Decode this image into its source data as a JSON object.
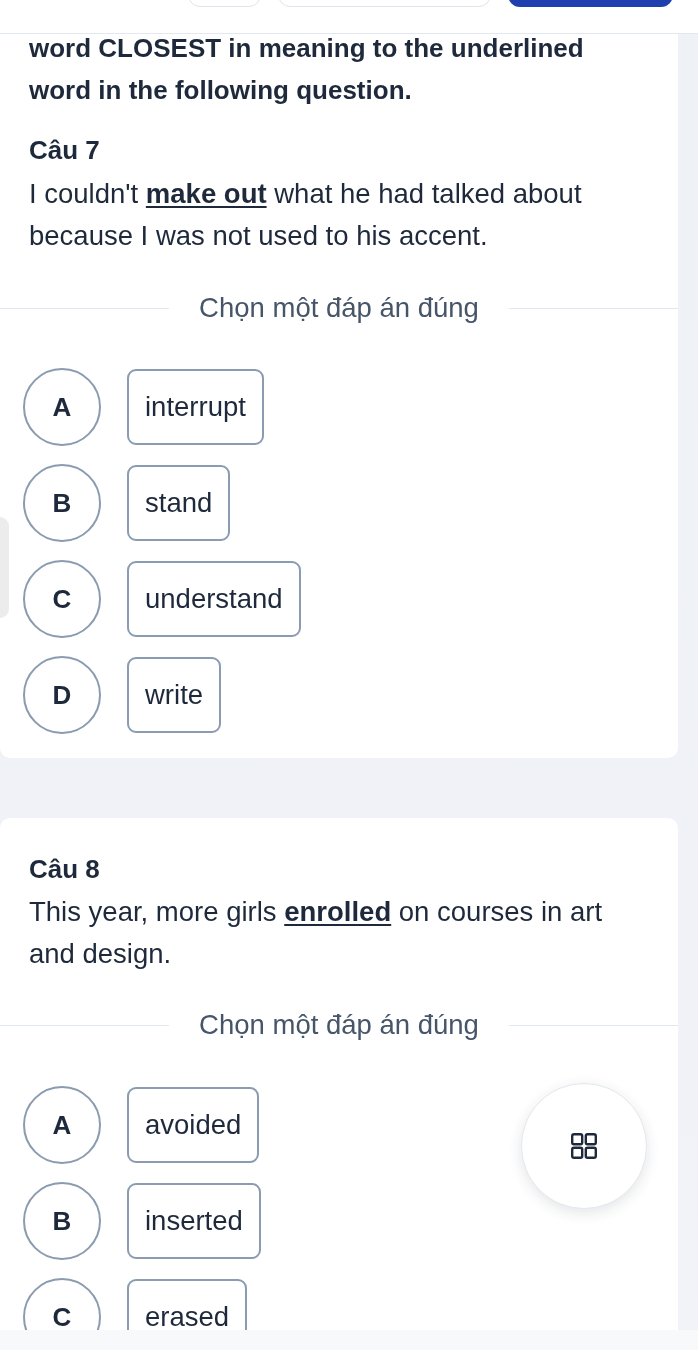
{
  "header": {
    "buttons": [
      {
        "kind": "outline"
      },
      {
        "kind": "outline"
      },
      {
        "kind": "primary"
      }
    ]
  },
  "questions": [
    {
      "instruction": "word CLOSEST in meaning to the underlined word in the following question.",
      "title": "Câu 7",
      "text": "I couldn't **make out** what he had talked about because I was not used to his accent.",
      "prompt": "Chọn một đáp án đúng",
      "options": [
        {
          "letter": "A",
          "text": "interrupt",
          "selected": false
        },
        {
          "letter": "B",
          "text": "stand",
          "selected": false
        },
        {
          "letter": "C",
          "text": "understand",
          "selected": false
        },
        {
          "letter": "D",
          "text": "write",
          "selected": false
        }
      ]
    },
    {
      "title": "Câu 8",
      "text": "This year, more girls **enrolled** on courses in art and design.",
      "prompt": "Chọn một đáp án đúng",
      "options": [
        {
          "letter": "A",
          "text": "avoided",
          "selected": false
        },
        {
          "letter": "B",
          "text": "inserted",
          "selected": false
        },
        {
          "letter": "C",
          "text": "erased",
          "selected": false
        }
      ]
    }
  ]
}
